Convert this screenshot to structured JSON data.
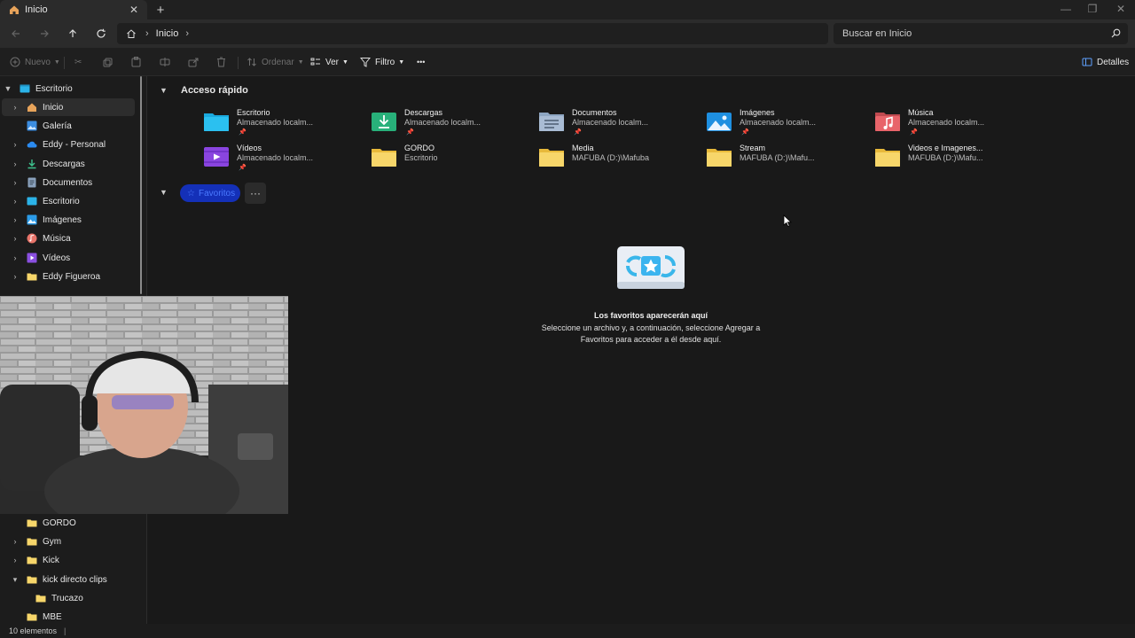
{
  "tab": {
    "title": "Inicio",
    "close": "✕",
    "new": "+"
  },
  "window_controls": {
    "minimize": "—",
    "maximize": "❐",
    "close": "✕"
  },
  "address": {
    "crumb": "Inicio",
    "chevron": "›"
  },
  "search": {
    "placeholder": "Buscar en Inicio"
  },
  "toolbar": {
    "new_label": "Nuevo",
    "sort_label": "Ordenar",
    "view_label": "Ver",
    "filter_label": "Filtro",
    "more_label": "•••",
    "details_label": "Detalles"
  },
  "sidebar": {
    "items": [
      {
        "label": "Escritorio",
        "icon": "desktop-icon"
      },
      {
        "label": "Inicio",
        "icon": "home-icon"
      },
      {
        "label": "Galería",
        "icon": "gallery-icon"
      },
      {
        "label": "Eddy - Personal",
        "icon": "onedrive-cloud-icon"
      },
      {
        "label": "Descargas",
        "icon": "downloads-icon"
      },
      {
        "label": "Documentos",
        "icon": "documents-icon"
      },
      {
        "label": "Escritorio",
        "icon": "desktop-icon"
      },
      {
        "label": "Imágenes",
        "icon": "pictures-icon"
      },
      {
        "label": "Música",
        "icon": "music-icon"
      },
      {
        "label": "Vídeos",
        "icon": "videos-icon"
      },
      {
        "label": "Eddy Figueroa",
        "icon": "folder-icon"
      },
      {
        "label": "GORDO",
        "icon": "folder-icon"
      },
      {
        "label": "Gym",
        "icon": "folder-icon"
      },
      {
        "label": "Kick",
        "icon": "folder-icon"
      },
      {
        "label": "kick directo clips",
        "icon": "folder-icon"
      },
      {
        "label": "Trucazo",
        "icon": "folder-icon"
      },
      {
        "label": "MBE",
        "icon": "folder-icon"
      }
    ]
  },
  "quick_access": {
    "title": "Acceso rápido",
    "items": [
      {
        "name": "Escritorio",
        "sub": "Almacenado localm...",
        "pinned": true,
        "icon": "desktop-folder-icon"
      },
      {
        "name": "Descargas",
        "sub": "Almacenado localm...",
        "pinned": true,
        "icon": "downloads-folder-icon"
      },
      {
        "name": "Documentos",
        "sub": "Almacenado localm...",
        "pinned": true,
        "icon": "documents-folder-icon"
      },
      {
        "name": "Imágenes",
        "sub": "Almacenado localm...",
        "pinned": true,
        "icon": "pictures-folder-icon"
      },
      {
        "name": "Música",
        "sub": "Almacenado localm...",
        "pinned": true,
        "icon": "music-folder-icon"
      },
      {
        "name": "Vídeos",
        "sub": "Almacenado localm...",
        "pinned": true,
        "icon": "videos-folder-icon"
      },
      {
        "name": "GORDO",
        "sub": "Escritorio",
        "pinned": false,
        "icon": "folder-icon"
      },
      {
        "name": "Media",
        "sub": "MAFUBA (D:)\\Mafuba",
        "pinned": false,
        "icon": "folder-icon"
      },
      {
        "name": "Stream",
        "sub": "MAFUBA (D:)\\Mafu...",
        "pinned": false,
        "icon": "folder-icon"
      },
      {
        "name": "Videos e Imagenes...",
        "sub": "MAFUBA (D:)\\Mafu...",
        "pinned": false,
        "icon": "folder-icon"
      }
    ]
  },
  "favorites": {
    "label": "Favoritos",
    "more": "···",
    "empty_title": "Los favoritos aparecerán aquí",
    "empty_line1": "Seleccione un archivo y, a continuación, seleccione Agregar a",
    "empty_line2": "Favoritos para acceder a él desde aquí."
  },
  "status": {
    "count": "10 elementos"
  },
  "colors": {
    "accent": "#1430b8",
    "folder": "#f7d66a",
    "background": "#191919"
  }
}
